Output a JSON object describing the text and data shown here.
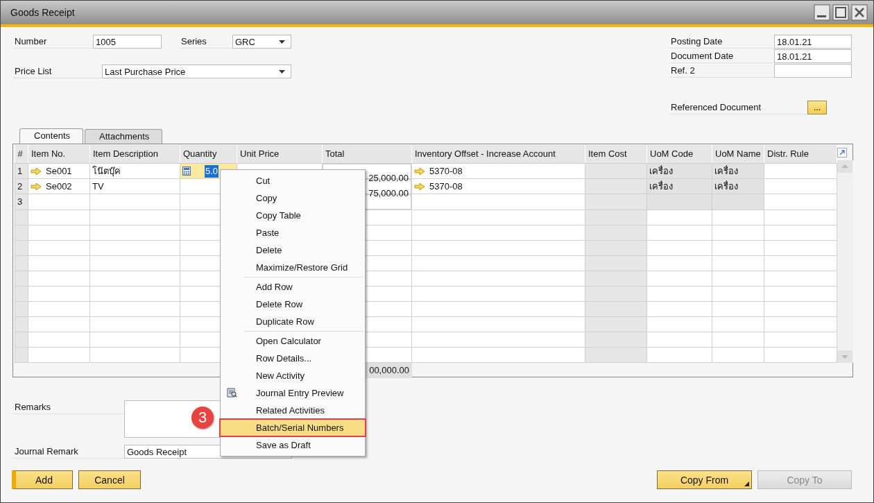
{
  "window": {
    "title": "Goods Receipt"
  },
  "header": {
    "number": {
      "label": "Number",
      "value": "1005"
    },
    "series": {
      "label": "Series",
      "value": "GRC"
    },
    "price_list": {
      "label": "Price List",
      "value": "Last Purchase Price"
    },
    "dates": [
      {
        "label": "Posting Date",
        "value": "18.01.21"
      },
      {
        "label": "Document Date",
        "value": "18.01.21"
      },
      {
        "label": "Ref. 2"
      }
    ],
    "referenced_document": {
      "label": "Referenced Document",
      "button": "..."
    }
  },
  "tabs": [
    {
      "label": "Contents",
      "selected": true
    },
    {
      "label": "Attachments",
      "selected": false
    }
  ],
  "table": {
    "columns": [
      {
        "label": "#",
        "read_only": true
      },
      {
        "label": "Item No.",
        "read_only": false
      },
      {
        "label": "Item Description",
        "read_only": false
      },
      {
        "label": "Quantity",
        "read_only": false
      },
      {
        "label": "Unit Price"
      },
      {
        "label": "Total",
        "read_only": false
      },
      {
        "label": "Inventory Offset - Increase Account",
        "read_only": false
      },
      {
        "label": "Item Cost",
        "read_only": true
      },
      {
        "label": "UoM Code",
        "read_only": false
      },
      {
        "label": "UoM Name",
        "read_only": false
      },
      {
        "label": "Distr. Rule",
        "read_only": false
      }
    ],
    "rows": [
      {
        "number": "1",
        "item_no": "Se001",
        "description": "โน๊ตบุ๊ค",
        "quantity": "5.0",
        "editing": true,
        "total": "25,000.00",
        "account": "5370-08",
        "uom_code": "เครื่อง",
        "uom_name": "เครื่อง",
        "locked": true
      },
      {
        "number": "2",
        "item_no": "Se002",
        "description": "TV",
        "quantity": "",
        "editing": false,
        "total": "75,000.00",
        "account": "5370-08",
        "uom_code": "เครื่อง",
        "uom_name": "เครื่อง",
        "locked": true
      },
      {
        "number": "3",
        "item_no": "",
        "description": "",
        "quantity": "",
        "editing": false,
        "total": "",
        "account": "",
        "uom_code": "",
        "uom_name": "",
        "locked": true
      }
    ],
    "footer_total": "00,000.00"
  },
  "remarks": {
    "label": "Remarks"
  },
  "journal_remark": {
    "label": "Journal Remark",
    "value": "Goods Receipt"
  },
  "buttons": [
    {
      "label": "Add",
      "kind": "primary",
      "disabled": false
    },
    {
      "label": "Cancel",
      "kind": "plain",
      "disabled": false
    },
    {
      "label": "Copy From",
      "kind": "dropdown",
      "disabled": false
    },
    {
      "label": "Copy To",
      "kind": "plain",
      "disabled": true
    }
  ],
  "context_menu": {
    "groups": [
      [
        {
          "label": "Cut",
          "kind": "plain",
          "selected": false
        },
        {
          "label": "Copy",
          "kind": "plain",
          "selected": false
        },
        {
          "label": "Copy Table",
          "kind": "plain",
          "selected": false
        },
        {
          "label": "Paste",
          "kind": "plain",
          "selected": false
        },
        {
          "label": "Delete",
          "kind": "plain",
          "selected": false
        },
        {
          "label": "Maximize/Restore Grid",
          "kind": "plain",
          "selected": false
        }
      ],
      [
        {
          "label": "Add Row",
          "kind": "plain",
          "selected": false
        },
        {
          "label": "Delete Row",
          "kind": "plain",
          "selected": false
        },
        {
          "label": "Duplicate Row",
          "kind": "plain",
          "selected": false
        }
      ],
      [
        {
          "label": "Open Calculator",
          "kind": "plain",
          "selected": false
        },
        {
          "label": "Row Details...",
          "kind": "plain",
          "selected": false
        },
        {
          "label": "New Activity",
          "kind": "plain",
          "selected": false
        },
        {
          "label": "Journal Entry Preview",
          "kind": "icon",
          "selected": false
        },
        {
          "label": "Related Activities",
          "kind": "plain",
          "selected": false
        },
        {
          "label": "Batch/Serial Numbers",
          "kind": "plain",
          "selected": true
        },
        {
          "label": "Save as Draft",
          "kind": "plain",
          "selected": false
        }
      ]
    ]
  },
  "step_badge": "3"
}
